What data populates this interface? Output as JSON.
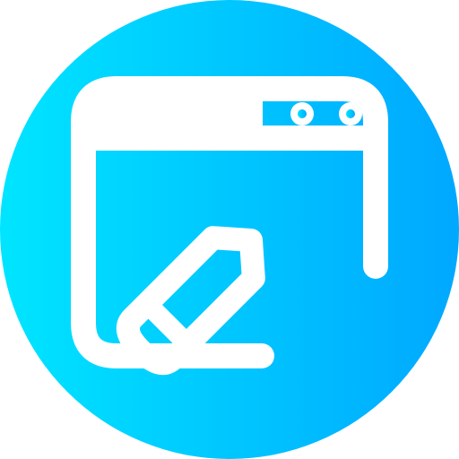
{
  "icon": {
    "name": "web-edit-icon",
    "gradient_start": "#00e5ff",
    "gradient_end": "#00a8ff",
    "stroke_color": "#ffffff"
  }
}
